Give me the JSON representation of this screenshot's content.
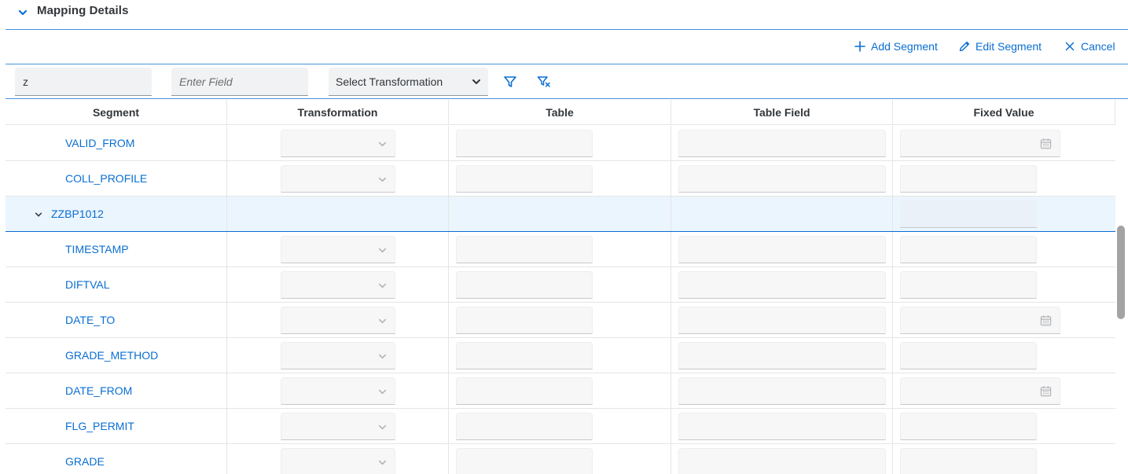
{
  "panel": {
    "title": "Mapping Details"
  },
  "toolbar": {
    "add_segment": "Add Segment",
    "edit_segment": "Edit Segment",
    "cancel": "Cancel"
  },
  "filters": {
    "segment_value": "z",
    "field_placeholder": "Enter Field",
    "transformation_selected": "Select Transformation"
  },
  "table": {
    "columns": [
      "Segment",
      "Transformation",
      "Table",
      "Table Field",
      "Fixed Value"
    ],
    "rows": [
      {
        "type": "field",
        "segment": "VALID_FROM",
        "fixed_kind": "date"
      },
      {
        "type": "field",
        "segment": "COLL_PROFILE",
        "fixed_kind": "text"
      },
      {
        "type": "group",
        "segment": "ZZBP1012",
        "expanded": true
      },
      {
        "type": "field",
        "segment": "TIMESTAMP",
        "fixed_kind": "text"
      },
      {
        "type": "field",
        "segment": "DIFTVAL",
        "fixed_kind": "text"
      },
      {
        "type": "field",
        "segment": "DATE_TO",
        "fixed_kind": "date"
      },
      {
        "type": "field",
        "segment": "GRADE_METHOD",
        "fixed_kind": "text"
      },
      {
        "type": "field",
        "segment": "DATE_FROM",
        "fixed_kind": "date"
      },
      {
        "type": "field",
        "segment": "FLG_PERMIT",
        "fixed_kind": "text"
      },
      {
        "type": "field",
        "segment": "GRADE",
        "fixed_kind": "text"
      }
    ]
  },
  "colors": {
    "accent": "#0a6ed1",
    "group_row_bg": "#ebf5fe",
    "text": "#32363a"
  }
}
